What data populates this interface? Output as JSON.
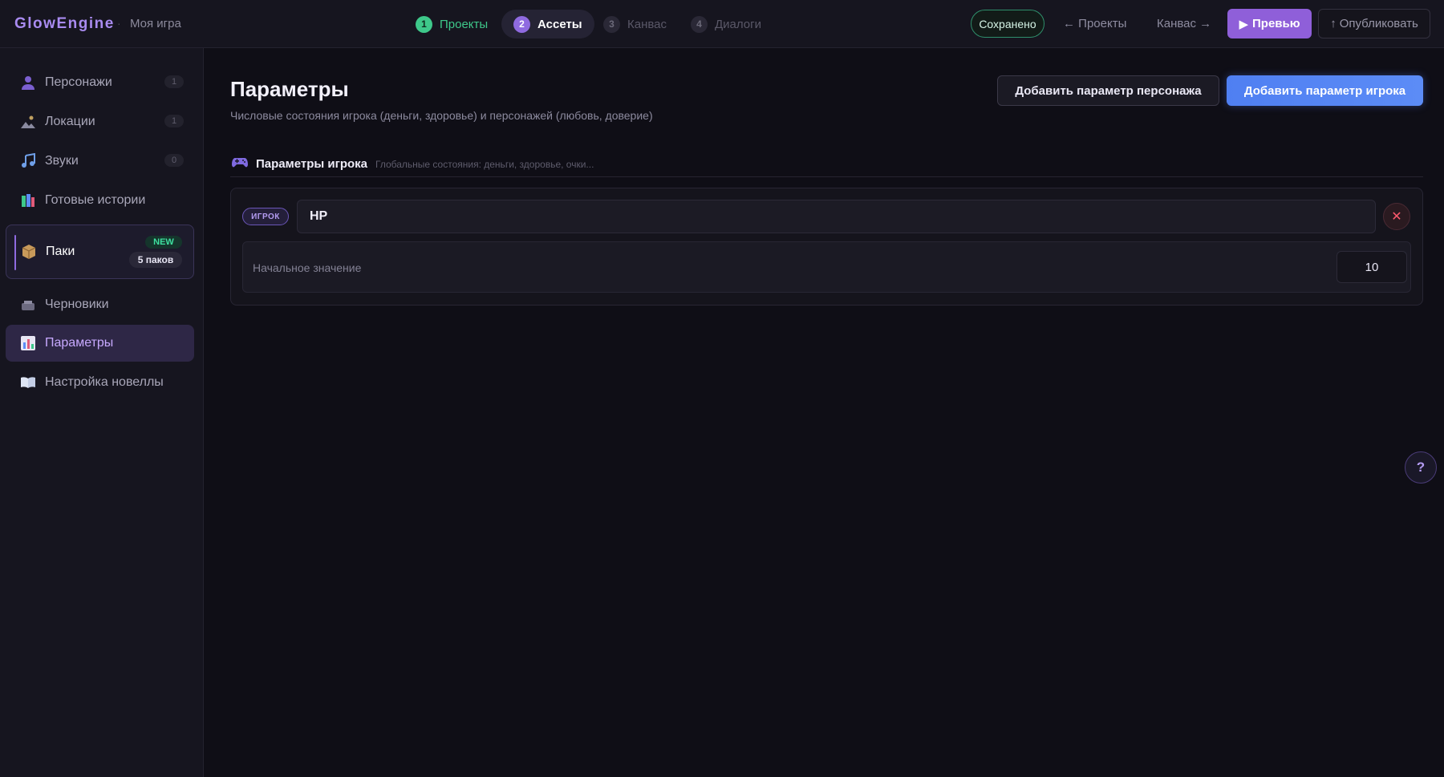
{
  "header": {
    "brand": "GlowEngine",
    "separator": "·",
    "project_name": "Моя игра",
    "steps": [
      {
        "num": "1",
        "label": "Проекты",
        "state": "done"
      },
      {
        "num": "2",
        "label": "Ассеты",
        "state": "active"
      },
      {
        "num": "3",
        "label": "Канвас",
        "state": "todo"
      },
      {
        "num": "4",
        "label": "Диалоги",
        "state": "todo"
      }
    ],
    "saved_label": "Сохранено",
    "back_link": "← Проекты",
    "forward_link": "Канвас →",
    "preview_icon": "▶",
    "preview_label": "Превью",
    "publish_icon": "↑",
    "publish_label": "Опубликовать"
  },
  "sidebar": {
    "items": [
      {
        "label": "Персонажи",
        "icon": "person-icon",
        "count": "1"
      },
      {
        "label": "Локации",
        "icon": "location-icon",
        "count": "1"
      },
      {
        "label": "Звуки",
        "icon": "music-note-icon",
        "count": "0"
      },
      {
        "label": "Готовые истории",
        "icon": "books-icon"
      },
      {
        "label": "Паки",
        "icon": "package-icon",
        "badge_new": "NEW",
        "badge_count": "5 паков"
      },
      {
        "label": "Черновики",
        "icon": "drafts-icon"
      },
      {
        "label": "Параметры",
        "icon": "chart-icon",
        "active": true
      },
      {
        "label": "Настройка новеллы",
        "icon": "book-icon"
      }
    ]
  },
  "main": {
    "title": "Параметры",
    "subtitle": "Числовые состояния игрока (деньги, здоровье) и персонажей (любовь, доверие)",
    "add_character_param": "Добавить параметр персонажа",
    "add_player_param": "Добавить параметр игрока",
    "section": {
      "title": "Параметры игрока",
      "hint": "Глобальные состояния: деньги, здоровье, очки..."
    },
    "params": [
      {
        "chip": "ИГРОК",
        "name": "HP",
        "initial_label": "Начальное значение",
        "initial_value": "10"
      }
    ]
  },
  "help_label": "?",
  "colors": {
    "accent": "#8f6ae0",
    "primary_button": "#5c8cf6",
    "success": "#3ec88a",
    "danger": "#ff5a6e",
    "background": "#0f0e16"
  }
}
